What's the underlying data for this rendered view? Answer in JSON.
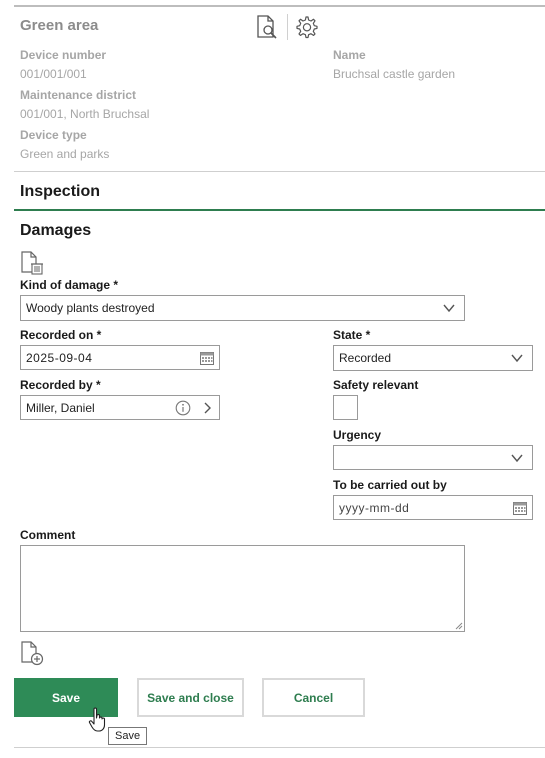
{
  "header": {
    "title": "Green area",
    "icons": [
      "document-search-icon",
      "gear-icon"
    ]
  },
  "meta": {
    "device_number_label": "Device number",
    "device_number_value": "001/001/001",
    "name_label": "Name",
    "name_value": "Bruchsal castle garden",
    "maintenance_district_label": "Maintenance district",
    "maintenance_district_value": "001/001, North Bruchsal",
    "device_type_label": "Device type",
    "device_type_value": "Green and parks"
  },
  "sections": {
    "inspection": "Inspection",
    "damages": "Damages"
  },
  "form": {
    "kind_of_damage_label": "Kind of damage *",
    "kind_of_damage_value": "Woody plants destroyed",
    "recorded_on_label": "Recorded on *",
    "recorded_on_value": "2025-09-04",
    "state_label": "State *",
    "state_value": "Recorded",
    "recorded_by_label": "Recorded by *",
    "recorded_by_value": "Miller, Daniel",
    "safety_relevant_label": "Safety relevant",
    "safety_relevant_checked": false,
    "urgency_label": "Urgency",
    "urgency_value": "",
    "carry_out_by_label": "To be carried out by",
    "carry_out_by_placeholder": "yyyy-mm-dd",
    "comment_label": "Comment",
    "comment_value": ""
  },
  "buttons": {
    "save": "Save",
    "save_and_close": "Save and close",
    "cancel": "Cancel"
  },
  "tooltip": {
    "text": "Save"
  },
  "colors": {
    "accent": "#2e8b57",
    "section_rule": "#2e7d4f"
  }
}
